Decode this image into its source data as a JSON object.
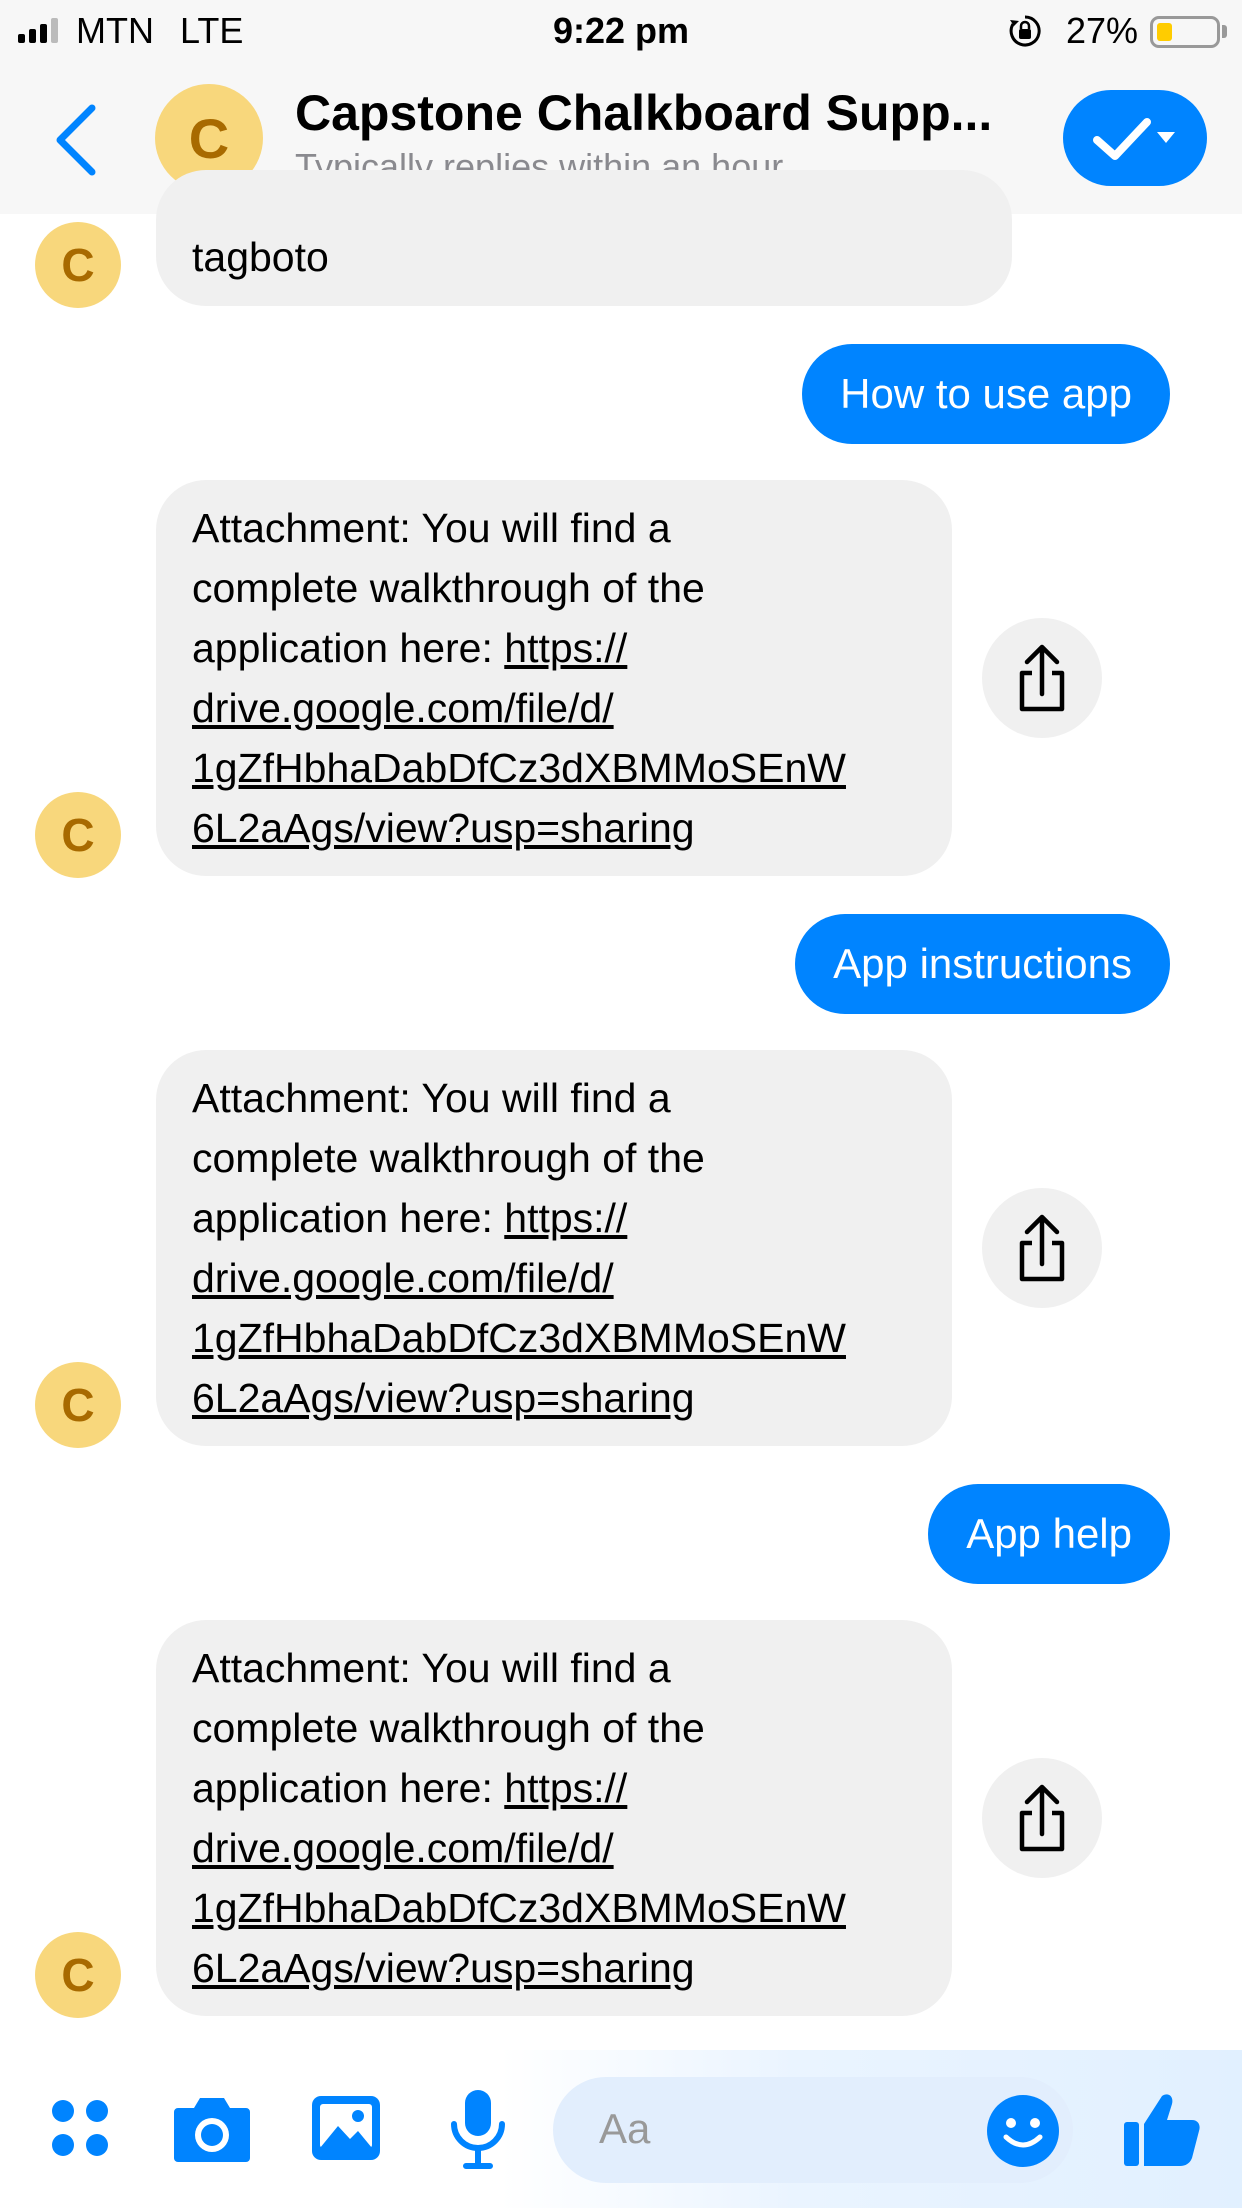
{
  "status_bar": {
    "carrier": "MTN",
    "network": "LTE",
    "time": "9:22 pm",
    "battery_percent": "27%",
    "battery_level": 0.27
  },
  "header": {
    "avatar_letter": "C",
    "title": "Capstone Chalkboard Supp...",
    "subtitle": "Typically replies within an hour",
    "icons": [
      "back-chevron-icon",
      "checkmark-dropdown-icon"
    ]
  },
  "messages": {
    "m0": {
      "text": "tagboto"
    },
    "m1": {
      "text": "How to use app"
    },
    "m2": {
      "prefix": "Attachment: You will find a",
      "line2": "complete walkthrough of the",
      "line3": "application here: ",
      "link1": "https://",
      "link2": "drive.google.com/file/d/",
      "link3": "1gZfHbhaDabDfCz3dXBMMoSEnW",
      "link4": "6L2aAgs/view?usp=sharing"
    },
    "m3": {
      "text": "App instructions"
    },
    "m4": {
      "prefix": "Attachment: You will find a",
      "line2": "complete walkthrough of the",
      "line3": "application here: ",
      "link1": "https://",
      "link2": "drive.google.com/file/d/",
      "link3": "1gZfHbhaDabDfCz3dXBMMoSEnW",
      "link4": "6L2aAgs/view?usp=sharing"
    },
    "m5": {
      "text": "App help"
    },
    "m6": {
      "prefix": "Attachment: You will find a",
      "line2": "complete walkthrough of the",
      "line3": "application here: ",
      "link1": "https://",
      "link2": "drive.google.com/file/d/",
      "link3": "1gZfHbhaDabDfCz3dXBMMoSEnW",
      "link4": "6L2aAgs/view?usp=sharing"
    },
    "avatar_letter": "C"
  },
  "composer": {
    "placeholder": "Aa",
    "icons": [
      "apps-grid-icon",
      "camera-icon",
      "photo-icon",
      "microphone-icon",
      "emoji-icon",
      "thumbs-up-icon"
    ]
  },
  "colors": {
    "accent": "#0084ff",
    "incoming_bubble": "#f0f0f0",
    "avatar_bg": "#f8d77c",
    "avatar_fg": "#a86a00"
  }
}
